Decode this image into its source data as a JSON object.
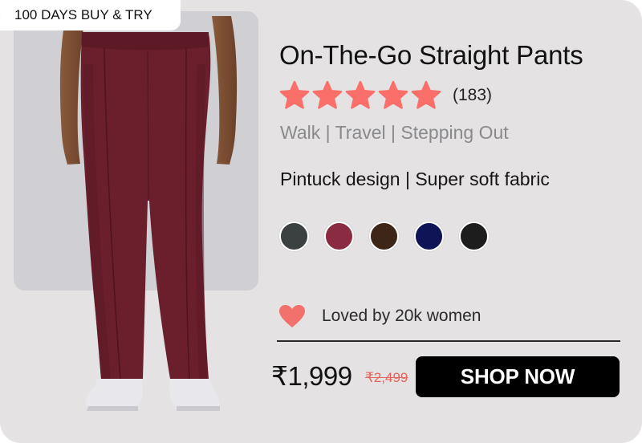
{
  "badge": {
    "label": "100 DAYS BUY & TRY"
  },
  "product": {
    "title": "On-The-Go Straight Pants",
    "rating_stars": 5,
    "review_count": "(183)",
    "usage": "Walk | Travel | Stepping Out",
    "features": "Pintuck design | Super soft fabric",
    "image_alt": "On-The-Go Straight Pants in maroon"
  },
  "swatches": [
    {
      "name": "slate-grey",
      "color": "#3a4140"
    },
    {
      "name": "berry",
      "color": "#8b2b42"
    },
    {
      "name": "brown",
      "color": "#3d2517"
    },
    {
      "name": "navy",
      "color": "#0e1456"
    },
    {
      "name": "black",
      "color": "#1d1d1d"
    }
  ],
  "social_proof": {
    "text": "Loved by 20k women"
  },
  "pricing": {
    "price": "₹1,999",
    "mrp": "₹2,499"
  },
  "cta": {
    "label": "SHOP NOW"
  },
  "colors": {
    "card_bg": "#e4e2e3",
    "star": "#fa6f6a",
    "heart": "#f2716c",
    "pants": "#6b1e2c",
    "button": "#000000"
  }
}
